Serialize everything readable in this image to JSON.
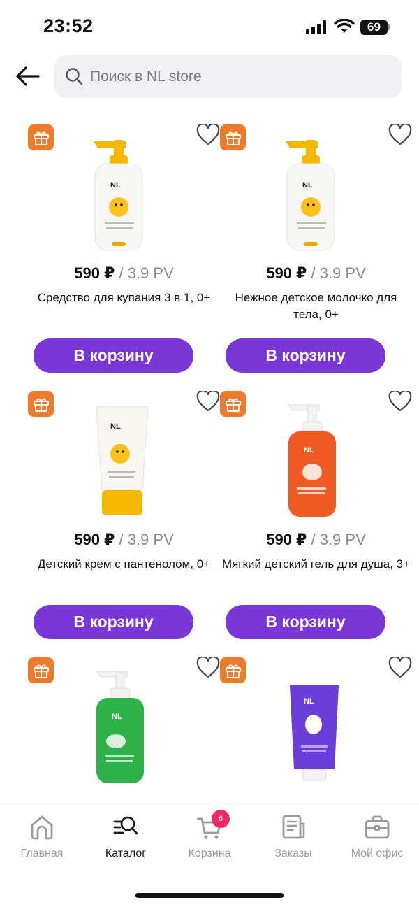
{
  "status_bar": {
    "time": "23:52",
    "battery": "69"
  },
  "search": {
    "placeholder": "Поиск в NL store"
  },
  "colors": {
    "accent": "#7a36d6",
    "gift": "#f07a2c",
    "badge": "#ee2a63"
  },
  "products": [
    {
      "price": "590 ₽",
      "pv": " / 3.9 PV",
      "name": "Средство для купания 3 в 1, 0+",
      "button": "В корзину",
      "image": "yellow-pump-bottle"
    },
    {
      "price": "590 ₽",
      "pv": " / 3.9 PV",
      "name": "Нежное детское молочко для тела, 0+",
      "button": "В корзину",
      "image": "yellow-pump-bottle"
    },
    {
      "price": "590 ₽",
      "pv": " / 3.9 PV",
      "name": "Детский крем с пантенолом, 0+",
      "button": "В корзину",
      "image": "yellow-cream-tube"
    },
    {
      "price": "590 ₽",
      "pv": " / 3.9 PV",
      "name": "Мягкий детский гель для душа, 3+",
      "button": "В корзину",
      "image": "orange-pump-bottle"
    },
    {
      "image": "green-pump-bottle"
    },
    {
      "image": "purple-toothpaste-tube"
    }
  ],
  "tabs": [
    {
      "label": "Главная",
      "icon": "home-icon"
    },
    {
      "label": "Каталог",
      "icon": "catalog-icon",
      "active": true
    },
    {
      "label": "Корзина",
      "icon": "cart-icon",
      "badge": "6"
    },
    {
      "label": "Заказы",
      "icon": "orders-icon"
    },
    {
      "label": "Мой офис",
      "icon": "office-icon"
    }
  ]
}
